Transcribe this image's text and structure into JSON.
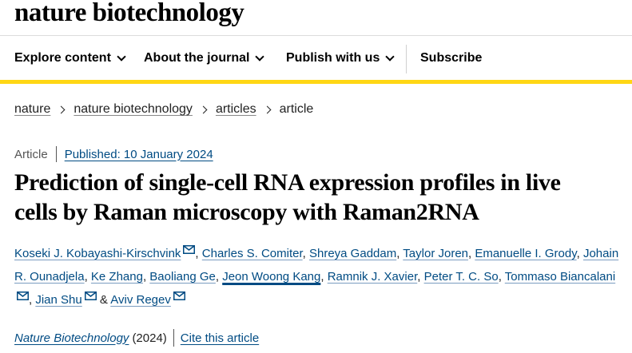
{
  "header": {
    "brand": "nature biotechnology"
  },
  "nav": {
    "explore": "Explore content",
    "about": "About the journal",
    "publish": "Publish with us",
    "subscribe": "Subscribe"
  },
  "breadcrumb": [
    "nature",
    "nature biotechnology",
    "articles",
    "article"
  ],
  "article": {
    "type": "Article",
    "published": "Published: 10 January 2024",
    "title_line1": "Prediction of single-cell RNA expression profiles in live",
    "title_line2": "cells by Raman microscopy with Raman2RNA",
    "authors": [
      "Koseki J. Kobayashi-Kirschvink",
      "Charles S. Comiter",
      "Shreya Gaddam",
      "Taylor Joren",
      "Emanuelle I. Grody",
      "Johain R. Ounadjela",
      "Ke Zhang",
      "Baoliang Ge",
      "Jeon Woong Kang",
      "Ramnik J. Xavier",
      "Peter T. C. So",
      "Tommaso Biancalani",
      "Jian Shu",
      "Aviv Regev"
    ],
    "connector": "&",
    "journal": "Nature Biotechnology",
    "year": "(2024)",
    "cite": "Cite this article"
  },
  "icons": {
    "mail": "mail-icon",
    "chevron": "chevron-down-icon"
  },
  "colors": {
    "accent": "#ffd714",
    "link": "#004b83"
  }
}
